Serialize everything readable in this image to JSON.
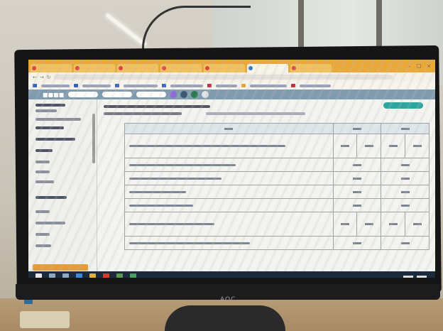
{
  "scene": {
    "description_kind": "photo of monitor showing web app with table",
    "monitor_brand": "AOC"
  },
  "browser": {
    "tabs": [
      "",
      "",
      "",
      "",
      "",
      "",
      "",
      ""
    ],
    "window_controls": [
      "–",
      "□",
      "×"
    ]
  },
  "app": {
    "sidebar_sections": 14
  },
  "table": {
    "rows": 9,
    "columns": 6
  },
  "taskbar": {
    "icon_count": 8
  },
  "colors": {
    "tab_bar": "#e9a83a",
    "app_header": "#7f9bb0",
    "accent_button": "#2fa5a0",
    "taskbar": "#1b2a3c",
    "bezel": "#151515"
  }
}
